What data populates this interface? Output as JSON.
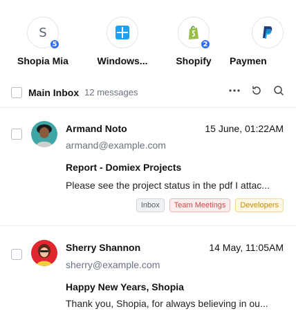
{
  "accounts": [
    {
      "label": "Shopia Mia",
      "letter": "S",
      "badge": "5",
      "icon": "letter-avatar"
    },
    {
      "label": "Windows...",
      "badge": "",
      "icon": "windows-icon"
    },
    {
      "label": "Shopify",
      "badge": "2",
      "icon": "shopify-icon"
    },
    {
      "label": "Paymen",
      "badge": "",
      "icon": "paypal-icon"
    }
  ],
  "header": {
    "title": "Main Inbox",
    "count": "12 messages",
    "icons": [
      "more-icon",
      "refresh-icon",
      "search-icon"
    ]
  },
  "mails": [
    {
      "sender": "Armand Noto",
      "date": "15 June, 01:22AM",
      "email": "armand@example.com",
      "subject": "Report - Domiex Projects",
      "preview": "Please see the project status in the pdf I attac...",
      "tags": [
        "Inbox",
        "Team Meetings",
        "Developers"
      ]
    },
    {
      "sender": "Sherry Shannon",
      "date": "14 May, 11:05AM",
      "email": "sherry@example.com",
      "subject": "Happy New Years, Shopia",
      "preview": "Thank you, Shopia, for always believing in ou...",
      "tags": []
    }
  ],
  "colors": {
    "badge": "#2f6df6",
    "windows": "#1ea1f2",
    "shopify": "#95bf47",
    "paypal_dark": "#253b80",
    "paypal_light": "#179bd7",
    "tag_team": "#d84646",
    "tag_dev": "#c98a00"
  }
}
